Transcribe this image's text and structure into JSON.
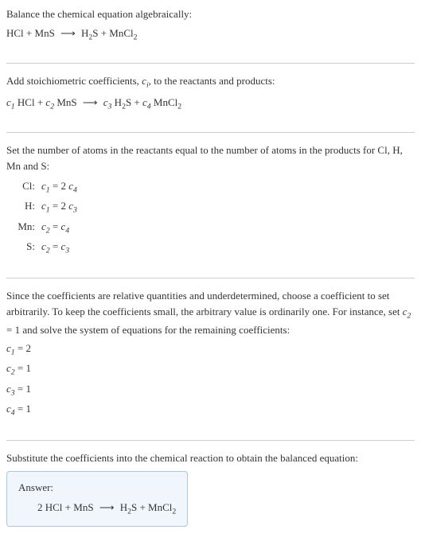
{
  "sec1": {
    "title": "Balance the chemical equation algebraically:"
  },
  "sec2": {
    "title_a": "Add stoichiometric coefficients, ",
    "title_b": ", to the reactants and products:"
  },
  "sec3": {
    "title": "Set the number of atoms in the reactants equal to the number of atoms in the products for Cl, H, Mn and S:",
    "rows": {
      "cl": {
        "label": "Cl:",
        "lhs_c": "c",
        "lhs_i": "1",
        "eq": " = 2 ",
        "rhs_c": "c",
        "rhs_i": "4"
      },
      "h": {
        "label": "H:",
        "lhs_c": "c",
        "lhs_i": "1",
        "eq": " = 2 ",
        "rhs_c": "c",
        "rhs_i": "3"
      },
      "mn": {
        "label": "Mn:",
        "lhs_c": "c",
        "lhs_i": "2",
        "eq": " = ",
        "rhs_c": "c",
        "rhs_i": "4"
      },
      "s": {
        "label": "S:",
        "lhs_c": "c",
        "lhs_i": "2",
        "eq": " = ",
        "rhs_c": "c",
        "rhs_i": "3"
      }
    }
  },
  "sec4": {
    "text_a": "Since the coefficients are relative quantities and underdetermined, choose a coefficient to set arbitrarily. To keep the coefficients small, the arbitrary value is ordinarily one. For instance, set ",
    "text_b": " = 1 and solve the system of equations for the remaining coefficients:",
    "coeffs": {
      "c1": {
        "c": "c",
        "i": "1",
        "val": " = 2"
      },
      "c2": {
        "c": "c",
        "i": "2",
        "val": " = 1"
      },
      "c3": {
        "c": "c",
        "i": "3",
        "val": " = 1"
      },
      "c4": {
        "c": "c",
        "i": "4",
        "val": " = 1"
      }
    }
  },
  "sec5": {
    "title": "Substitute the coefficients into the chemical reaction to obtain the balanced equation:"
  },
  "answer": {
    "label": "Answer:"
  },
  "chem": {
    "HCl": "HCl",
    "plus": " + ",
    "MnS": "MnS",
    "arrow": "⟶",
    "H": "H",
    "two": "2",
    "S": "S",
    "MnCl": "MnCl",
    "c": "c",
    "i1": "1",
    "i2": "2",
    "i3": "3",
    "i4": "4",
    "ci_c": "c",
    "ci_i": "i",
    "space": " ",
    "two_pre": "2 "
  }
}
